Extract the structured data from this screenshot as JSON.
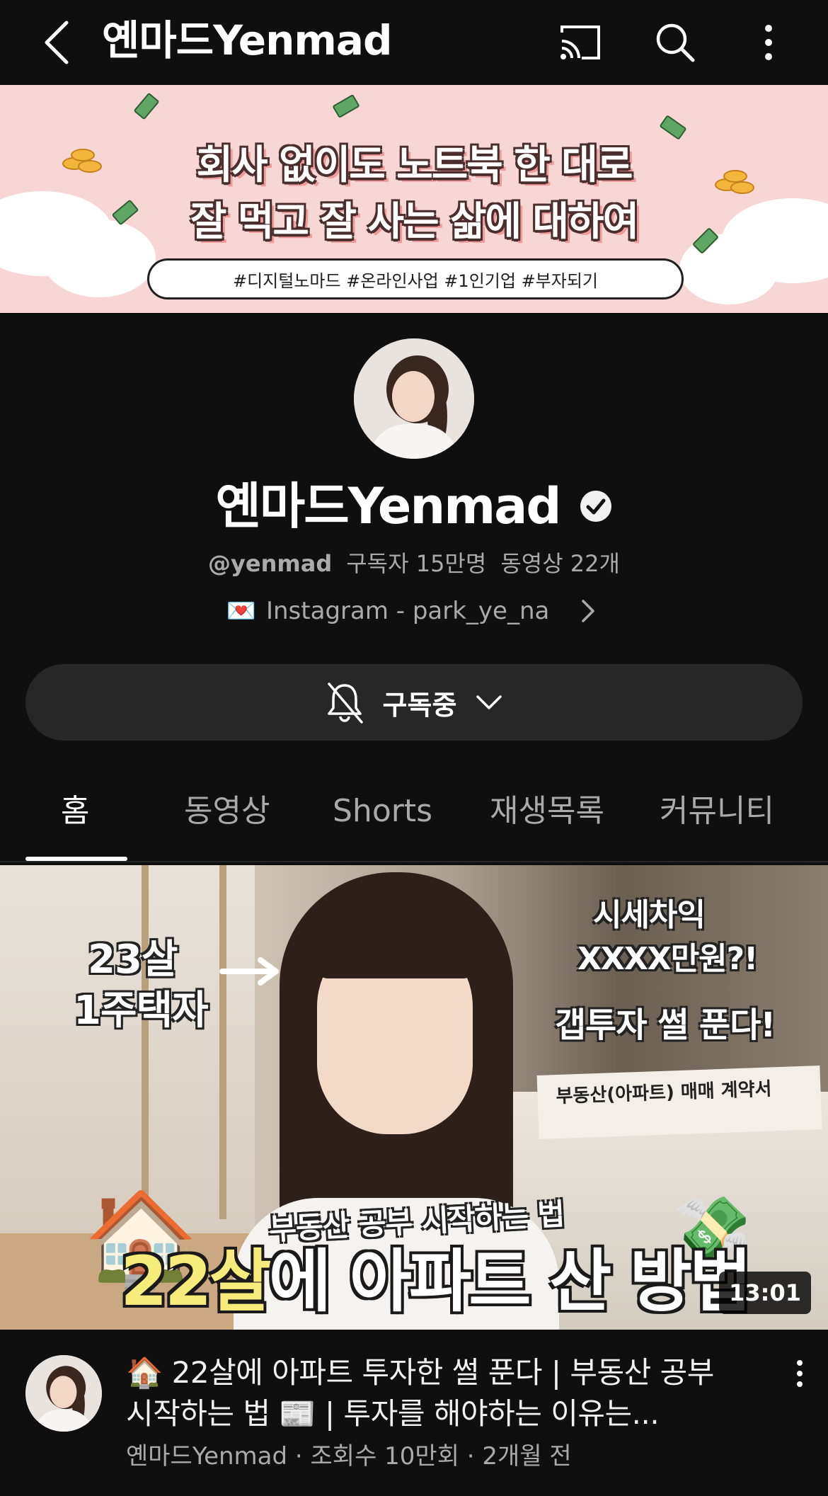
{
  "header": {
    "title": "옌마드Yenmad",
    "back_icon": "back-arrow-icon",
    "cast_icon": "cast-icon",
    "search_icon": "search-icon",
    "more_icon": "more-vertical-icon"
  },
  "banner": {
    "line1": "회사 없이도 노트북 한 대로",
    "line2": "잘 먹고 잘 사는 삶에 대하여",
    "tags": "#디지털노마드 #온라인사업 #1인기업 #부자되기",
    "background_color": "#f8d6d6"
  },
  "channel": {
    "name": "옌마드Yenmad",
    "verified_icon": "verified-check-icon",
    "handle": "@yenmad",
    "subscribers": "구독자 15만명",
    "video_count": "동영상 22개",
    "link_emoji": "💌",
    "link_text": "Instagram - park_ye_na"
  },
  "subscribe_button": {
    "label": "구독중",
    "bell_icon": "bell-off-icon",
    "chevron_icon": "chevron-down-icon"
  },
  "tabs": [
    {
      "label": "홈",
      "active": true
    },
    {
      "label": "동영상",
      "active": false
    },
    {
      "label": "Shorts",
      "active": false
    },
    {
      "label": "재생목록",
      "active": false
    },
    {
      "label": "커뮤니티",
      "active": false
    }
  ],
  "video": {
    "thumbnail": {
      "left_text_1": "23살",
      "left_text_2": "1주택자",
      "right_text_1": "시세차익",
      "right_text_2": "XXXX만원?!",
      "right_text_3": "갭투자 썰 푼다!",
      "document_text": "부동산(아파트) 매매 계약서",
      "subtitle": "부동산 공부 시작하는 법",
      "headline_highlight": "22살",
      "headline_rest": "에 아파트 산 방법",
      "house_emoji": "🏠",
      "money_emoji": "💸"
    },
    "duration": "13:01",
    "title": "🏠 22살에 아파트 투자한 썰 푼다 | 부동산 공부 시작하는 법 📰 | 투자를 해야하는 이유는...",
    "meta": "옌마드Yenmad · 조회수 10만회 · 2개월 전",
    "more_icon": "more-vertical-icon"
  },
  "colors": {
    "background": "#0f0f0f",
    "button_bg": "#272727",
    "secondary_text": "#aaaaaa",
    "highlight_yellow": "#f5ec7b"
  }
}
